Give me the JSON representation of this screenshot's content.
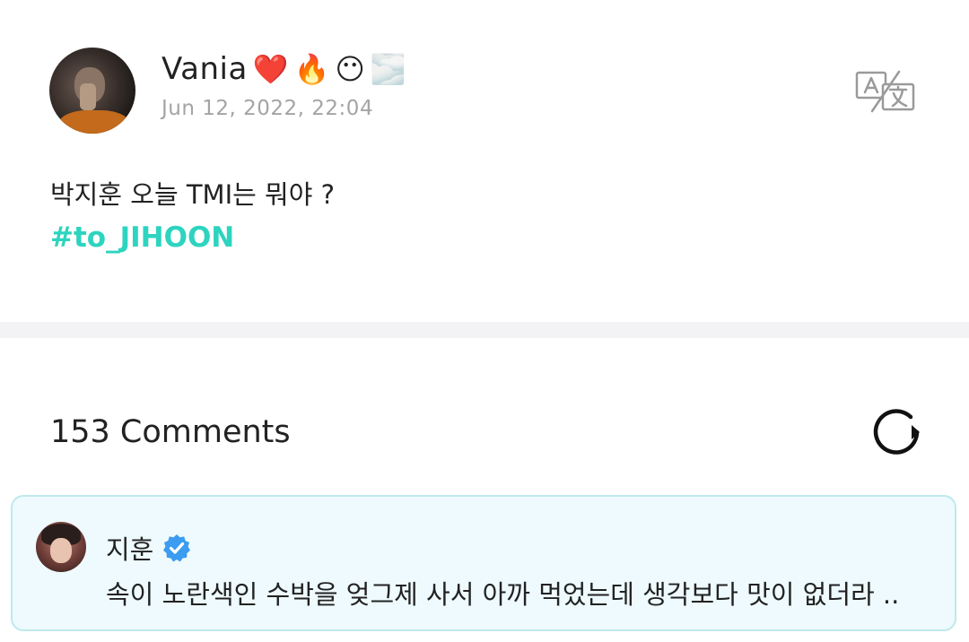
{
  "post": {
    "author": {
      "name": "Vania",
      "emojis": [
        "❤️",
        "🔥",
        "😶",
        "🌫️"
      ]
    },
    "timestamp": "Jun 12, 2022, 22:04",
    "text": "박지훈 오늘 TMI는 뭐야 ?",
    "hashtag": "#to_JIHOON"
  },
  "comments": {
    "header": "153 Comments",
    "highlighted": {
      "author": "지훈",
      "verified": true,
      "text": "속이 노란색인 수박을 엊그제 사서 아까 먹었는데 생각보다 맛이 없더라 .."
    }
  },
  "icons": {
    "translate": "translate-icon",
    "refresh": "refresh-icon",
    "verified": "verified-badge-icon"
  },
  "colors": {
    "hashtag": "#2dd4bf",
    "timestamp": "#a4a4a4",
    "comment_card_bg": "#eefafd",
    "comment_card_border": "#bfe9ee",
    "verified_badge": "#3b9cf0",
    "divider": "#f3f3f5"
  }
}
